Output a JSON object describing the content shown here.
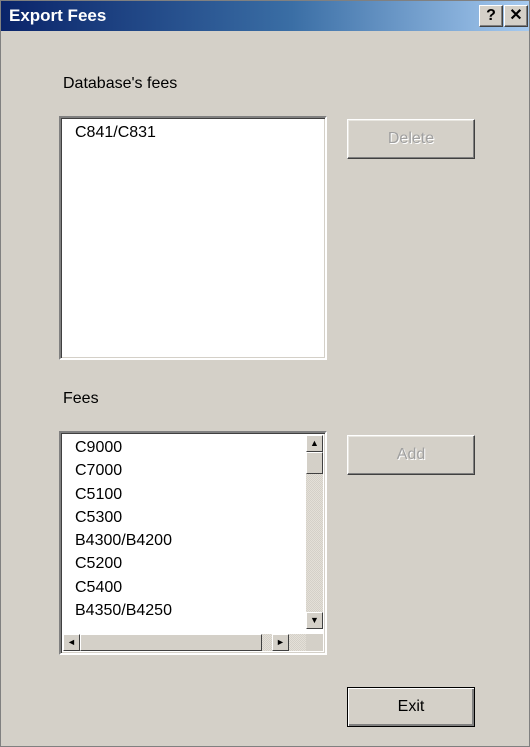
{
  "window": {
    "title": "Export Fees",
    "help_glyph": "?",
    "close_glyph": "✕"
  },
  "database_fees": {
    "label": "Database's fees",
    "items": [
      "C841/C831"
    ]
  },
  "fees": {
    "label": "Fees",
    "items": [
      "C9000",
      "C7000",
      "C5100",
      "C5300",
      "B4300/B4200",
      "C5200",
      "C5400",
      "B4350/B4250"
    ]
  },
  "buttons": {
    "delete": "Delete",
    "add": "Add",
    "exit": "Exit"
  },
  "scroll_glyphs": {
    "up": "▲",
    "down": "▼",
    "left": "◄",
    "right": "►"
  },
  "colors": {
    "dialog_bg": "#d4d0c8",
    "title_start": "#0a246a",
    "title_end": "#a6caf0",
    "disabled_text": "#a0a0a0"
  }
}
